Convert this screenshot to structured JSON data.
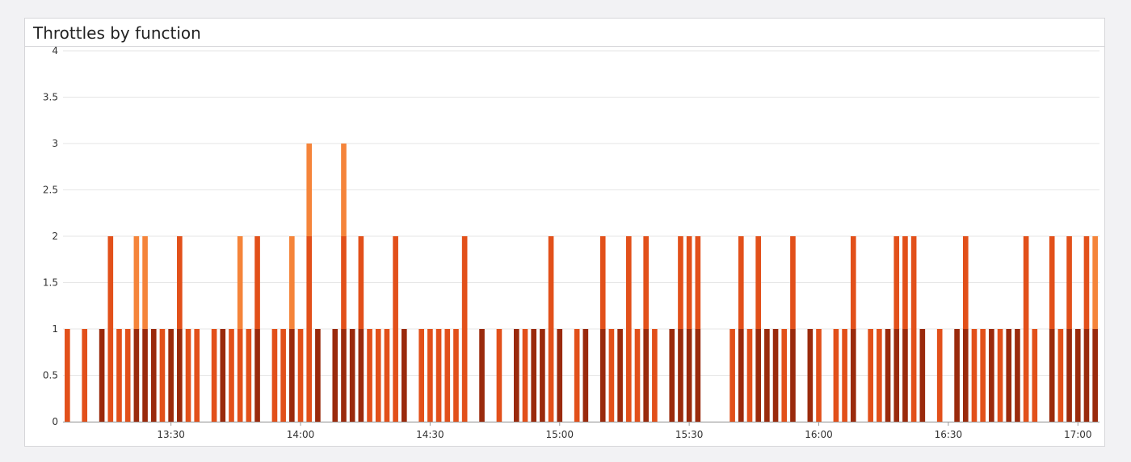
{
  "panel": {
    "title": "Throttles by function"
  },
  "chart_data": {
    "type": "bar",
    "stacked": true,
    "title": "Throttles by function",
    "xlabel": "",
    "ylabel": "",
    "ylim": [
      0,
      4
    ],
    "grid": true,
    "y_ticks": [
      "0",
      "0.5",
      "1",
      "1.5",
      "2",
      "2.5",
      "3",
      "3.5",
      "4"
    ],
    "x_ticks": [
      "13:30",
      "14:00",
      "14:30",
      "15:00",
      "15:30",
      "16:00",
      "16:30",
      "17:00"
    ],
    "x_tick_slots": [
      12.5,
      27.5,
      42.5,
      57.5,
      72.5,
      87.5,
      102.5,
      117.5
    ],
    "slot_count": 120,
    "colors": [
      "#9a2a0c",
      "#e2501a",
      "#f5843a"
    ],
    "bars": [
      [
        0,
        1,
        0
      ],
      [
        0,
        0,
        0
      ],
      [
        0,
        1,
        0
      ],
      [
        0,
        0,
        0
      ],
      [
        1,
        0,
        0
      ],
      [
        0,
        2,
        0
      ],
      [
        0,
        1,
        0
      ],
      [
        0,
        1,
        0
      ],
      [
        1,
        0,
        1
      ],
      [
        1,
        0,
        1
      ],
      [
        1,
        0,
        0
      ],
      [
        0,
        1,
        0
      ],
      [
        1,
        0,
        0
      ],
      [
        1,
        1,
        0
      ],
      [
        0,
        1,
        0
      ],
      [
        0,
        1,
        0
      ],
      [
        0,
        0,
        0
      ],
      [
        0,
        1,
        0
      ],
      [
        1,
        0,
        0
      ],
      [
        0,
        1,
        0
      ],
      [
        0,
        1,
        1
      ],
      [
        0,
        1,
        0
      ],
      [
        1,
        1,
        0
      ],
      [
        0,
        0,
        0
      ],
      [
        0,
        1,
        0
      ],
      [
        0,
        1,
        0
      ],
      [
        1,
        0,
        1
      ],
      [
        0,
        1,
        0
      ],
      [
        0,
        2,
        1
      ],
      [
        1,
        0,
        0
      ],
      [
        0,
        0,
        0
      ],
      [
        1,
        0,
        0
      ],
      [
        1,
        1,
        1
      ],
      [
        1,
        0,
        0
      ],
      [
        1,
        1,
        0
      ],
      [
        0,
        1,
        0
      ],
      [
        0,
        1,
        0
      ],
      [
        0,
        1,
        0
      ],
      [
        0,
        2,
        0
      ],
      [
        1,
        0,
        0
      ],
      [
        0,
        0,
        0
      ],
      [
        0,
        1,
        0
      ],
      [
        0,
        1,
        0
      ],
      [
        0,
        1,
        0
      ],
      [
        0,
        1,
        0
      ],
      [
        0,
        1,
        0
      ],
      [
        0,
        2,
        0
      ],
      [
        0,
        0,
        0
      ],
      [
        1,
        0,
        0
      ],
      [
        0,
        0,
        0
      ],
      [
        0,
        1,
        0
      ],
      [
        0,
        0,
        0
      ],
      [
        1,
        0,
        0
      ],
      [
        0,
        1,
        0
      ],
      [
        1,
        0,
        0
      ],
      [
        1,
        0,
        0
      ],
      [
        0,
        2,
        0
      ],
      [
        1,
        0,
        0
      ],
      [
        0,
        0,
        0
      ],
      [
        0,
        1,
        0
      ],
      [
        1,
        0,
        0
      ],
      [
        0,
        0,
        0
      ],
      [
        1,
        1,
        0
      ],
      [
        0,
        1,
        0
      ],
      [
        1,
        0,
        0
      ],
      [
        0,
        2,
        0
      ],
      [
        0,
        1,
        0
      ],
      [
        1,
        1,
        0
      ],
      [
        0,
        1,
        0
      ],
      [
        0,
        0,
        0
      ],
      [
        1,
        0,
        0
      ],
      [
        1,
        1,
        0
      ],
      [
        1,
        1,
        0
      ],
      [
        1,
        1,
        0
      ],
      [
        0,
        0,
        0
      ],
      [
        0,
        0,
        0
      ],
      [
        0,
        0,
        0
      ],
      [
        0,
        1,
        0
      ],
      [
        1,
        1,
        0
      ],
      [
        0,
        1,
        0
      ],
      [
        1,
        1,
        0
      ],
      [
        1,
        0,
        0
      ],
      [
        1,
        0,
        0
      ],
      [
        0,
        1,
        0
      ],
      [
        1,
        1,
        0
      ],
      [
        0,
        0,
        0
      ],
      [
        1,
        0,
        0
      ],
      [
        0,
        1,
        0
      ],
      [
        0,
        0,
        0
      ],
      [
        0,
        1,
        0
      ],
      [
        0,
        1,
        0
      ],
      [
        1,
        1,
        0
      ],
      [
        0,
        0,
        0
      ],
      [
        0,
        1,
        0
      ],
      [
        0,
        1,
        0
      ],
      [
        1,
        0,
        0
      ],
      [
        1,
        1,
        0
      ],
      [
        1,
        1,
        0
      ],
      [
        0,
        2,
        0
      ],
      [
        1,
        0,
        0
      ],
      [
        0,
        0,
        0
      ],
      [
        0,
        1,
        0
      ],
      [
        0,
        0,
        0
      ],
      [
        1,
        0,
        0
      ],
      [
        1,
        1,
        0
      ],
      [
        0,
        1,
        0
      ],
      [
        0,
        1,
        0
      ],
      [
        1,
        0,
        0
      ],
      [
        0,
        1,
        0
      ],
      [
        1,
        0,
        0
      ],
      [
        1,
        0,
        0
      ],
      [
        0,
        2,
        0
      ],
      [
        0,
        1,
        0
      ],
      [
        0,
        0,
        0
      ],
      [
        1,
        1,
        0
      ],
      [
        0,
        1,
        0
      ],
      [
        1,
        1,
        0
      ],
      [
        1,
        0,
        0
      ],
      [
        1,
        1,
        0
      ],
      [
        1,
        0,
        1
      ]
    ]
  }
}
